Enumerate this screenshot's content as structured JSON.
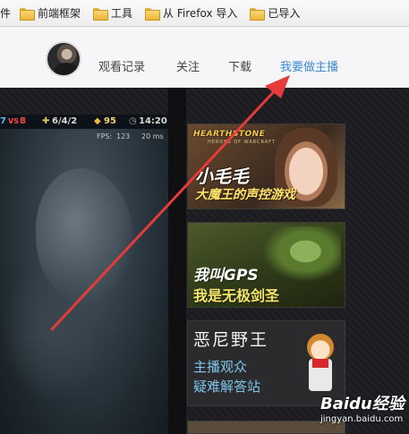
{
  "bookmarks": {
    "items": [
      {
        "label": "件"
      },
      {
        "label": "前端框架"
      },
      {
        "label": "工具"
      },
      {
        "label": "从 Firefox 导入"
      },
      {
        "label": "已导入"
      }
    ]
  },
  "header": {
    "nav": [
      {
        "label": "观看记录"
      },
      {
        "label": "关注"
      },
      {
        "label": "下载"
      },
      {
        "label": "我要做主播",
        "highlighted": true
      }
    ],
    "highlight_color": "#3a8bd8"
  },
  "game_hud": {
    "score_left": "7",
    "vs": "VS",
    "score_right": "8",
    "kda": "6/4/2",
    "gold": "95",
    "time": "14:20",
    "fps_label": "FPS:",
    "fps": "123",
    "ping": "20 ms"
  },
  "banners": {
    "b1": {
      "logo": "HEARTHSTONE",
      "logo_sub": "HEROES OF WARCRAFT",
      "title": "小毛毛",
      "subtitle": "大魔王的声控游戏"
    },
    "b2": {
      "line1": "我叫GPS",
      "line2": "我是无极剑圣"
    },
    "b3": {
      "title": "恶尼野王",
      "line1": "主播观众",
      "line2": "疑难解答站"
    }
  },
  "watermark": {
    "logo": "Baidu经验",
    "url": "jingyan.baidu.com"
  },
  "colors": {
    "arrow": "#e63b3b"
  }
}
